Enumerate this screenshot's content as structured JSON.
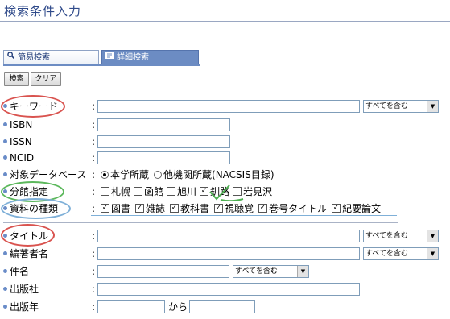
{
  "page_title": "検索条件入力",
  "tabs": [
    {
      "label": "簡易検索",
      "icon": "magnifier-icon"
    },
    {
      "label": "詳細検索",
      "icon": "list-icon"
    }
  ],
  "buttons": {
    "search": "検索",
    "clear": "クリア"
  },
  "fields": {
    "keyword": {
      "label": "キーワード",
      "value": "",
      "match": "すべてを含む"
    },
    "isbn": {
      "label": "ISBN",
      "value": ""
    },
    "issn": {
      "label": "ISSN",
      "value": ""
    },
    "ncid": {
      "label": "NCID",
      "value": ""
    },
    "scope": {
      "label": "対象データベース",
      "options": [
        "本学所蔵",
        "他機関所蔵(NACSIS目録)"
      ],
      "selected": "本学所蔵"
    },
    "branch": {
      "label": "分館指定",
      "options": [
        "札幌",
        "函館",
        "旭川",
        "釧路",
        "岩見沢"
      ],
      "checked": [
        "釧路"
      ]
    },
    "material": {
      "label": "資料の種類",
      "options": [
        "図書",
        "雑誌",
        "教科書",
        "視聴覚",
        "巻号タイトル",
        "紀要論文"
      ],
      "checked": [
        "図書",
        "雑誌",
        "教科書",
        "視聴覚",
        "巻号タイトル",
        "紀要論文"
      ]
    },
    "title": {
      "label": "タイトル",
      "value": "",
      "match": "すべてを含む"
    },
    "author": {
      "label": "編著者名",
      "value": "",
      "match": "すべてを含む"
    },
    "subject": {
      "label": "件名",
      "value": "",
      "match": "すべてを含む"
    },
    "publisher": {
      "label": "出版社",
      "value": ""
    },
    "pubyear": {
      "label": "出版年",
      "from": "",
      "range_word": "から",
      "to": ""
    }
  },
  "colors": {
    "accent": "#6c8cc3",
    "circle_red": "#d9534f",
    "circle_green": "#5cb85c",
    "circle_blue": "#7fb0d8",
    "check_green": "#4caf50"
  }
}
